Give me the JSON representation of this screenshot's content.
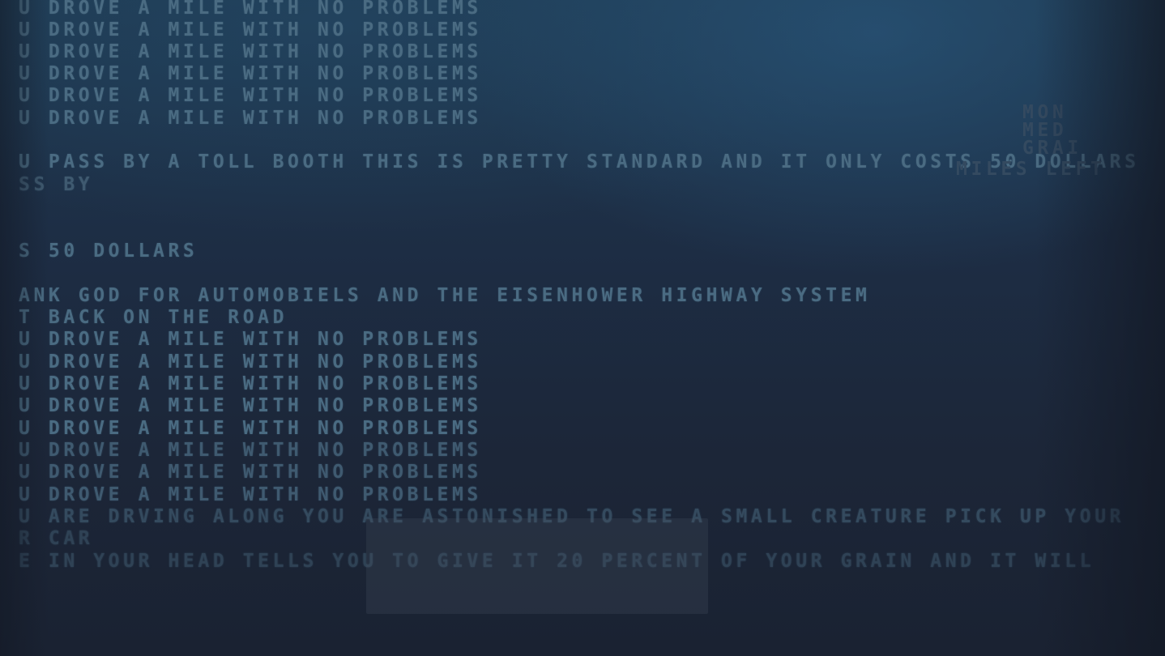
{
  "log": {
    "lines": [
      "U DROVE A MILE WITH NO PROBLEMS",
      "U DROVE A MILE WITH NO PROBLEMS",
      "U DROVE A MILE WITH NO PROBLEMS",
      "U DROVE A MILE WITH NO PROBLEMS",
      "U DROVE A MILE WITH NO PROBLEMS",
      "U DROVE A MILE WITH NO PROBLEMS",
      "U PASS BY A TOLL BOOTH THIS IS PRETTY STANDARD AND IT ONLY COSTS 50 DOLLARS",
      "SS BY",
      "S 50 DOLLARS",
      "ANK GOD FOR AUTOMOBIELS AND THE EISENHOWER HIGHWAY SYSTEM",
      "T BACK ON THE ROAD",
      "U DROVE A MILE WITH NO PROBLEMS",
      "U DROVE A MILE WITH NO PROBLEMS",
      "U DROVE A MILE WITH NO PROBLEMS",
      "U DROVE A MILE WITH NO PROBLEMS",
      "U DROVE A MILE WITH NO PROBLEMS",
      "U DROVE A MILE WITH NO PROBLEMS",
      "U DROVE A MILE WITH NO PROBLEMS",
      "U DROVE A MILE WITH NO PROBLEMS",
      "U ARE DRVING ALONG YOU ARE ASTONISHED TO SEE A SMALL CREATURE PICK UP YOUR",
      "R CAR",
      "E IN YOUR HEAD TELLS YOU TO GIVE IT 20 PERCENT OF YOUR GRAIN AND IT WILL"
    ]
  },
  "hud": {
    "line1": "MON",
    "line2": "MED",
    "line3": "GRAI",
    "miles_left": "MILES LEFT"
  }
}
